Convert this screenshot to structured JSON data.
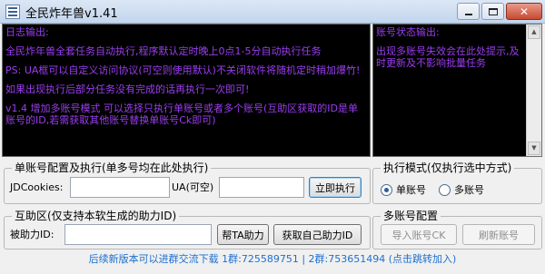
{
  "window": {
    "title": "全民炸年兽v1.41",
    "controls": {
      "minimize": "",
      "maximize": "",
      "close": "✕"
    }
  },
  "log_console": {
    "lines": [
      "日志输出:",
      "",
      "全民炸年兽全套任务自动执行,程序默认定时晚上0点1-5分自动执行任务",
      "",
      "PS: UA框可以自定义访问协议(可空则使用默认)不关闭软件将随机定时稍加爆竹!",
      "",
      "如果出现执行后部分任务没有完成的话再执行一次即可!",
      "",
      "v1.4 增加多账号模式 可以选择只执行单账号或者多个账号(互助区获取的ID是单账号的ID,若需获取其他账号替换单账号Ck即可)"
    ]
  },
  "status_console": {
    "lines": [
      "账号状态输出:",
      "",
      "出现多账号失效会在此处提示,及时更新及不影响批量任务"
    ]
  },
  "single_account": {
    "title": "单账号配置及执行(单多号均在此处执行)",
    "cookie_label": "JDCookies:",
    "cookie_value": "",
    "ua_label": "UA(可空)",
    "ua_value": "",
    "run_button": "立即执行"
  },
  "help_zone": {
    "title": "互助区(仅支持本软生成的助力ID)",
    "assisted_label": "被助力ID:",
    "assisted_value": "",
    "help_ta_button": "帮TA助力",
    "get_own_button": "获取自己助力ID"
  },
  "exec_mode": {
    "title": "执行模式(仅执行选中方式)",
    "options": [
      {
        "label": "单账号",
        "selected": true
      },
      {
        "label": "多账号",
        "selected": false
      }
    ]
  },
  "multi_account": {
    "title": "多账号配置",
    "import_button": "导入账号CK",
    "refresh_button": "刷新账号"
  },
  "footer": {
    "text": "后续新版本可以进群交流下载 1群:725589751 | 2群:753651494 (点击跳转加入)"
  },
  "colors": {
    "console_bg": "#000000",
    "console_text": "#9b3df0",
    "footer_link": "#1d6fd1"
  },
  "icons": {
    "app": "app-icon",
    "scroll_up": "scroll-up-icon",
    "scroll_down": "scroll-down-icon"
  }
}
